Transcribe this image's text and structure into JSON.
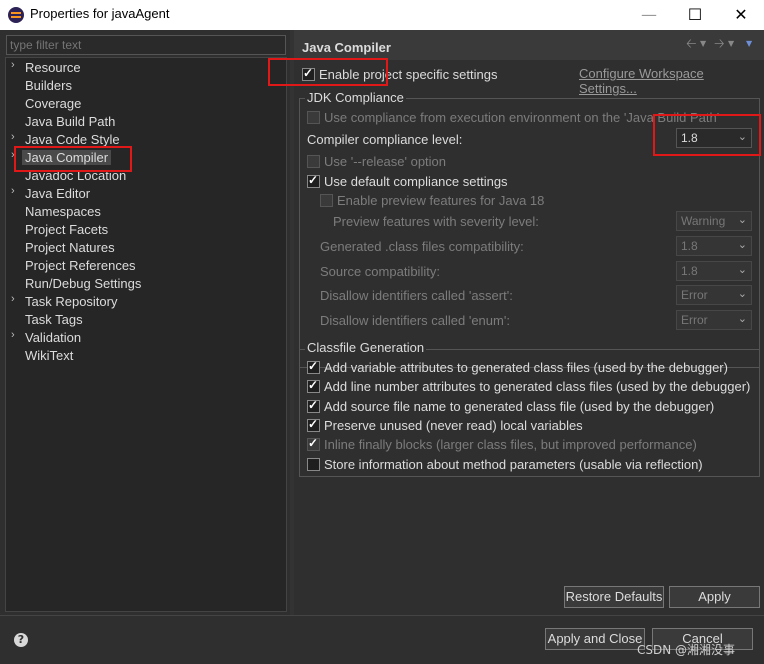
{
  "window": {
    "title": "Properties for javaAgent"
  },
  "filter": {
    "placeholder": "type filter text"
  },
  "tree": [
    {
      "label": "Resource",
      "expandable": true
    },
    {
      "label": "Builders",
      "expandable": false
    },
    {
      "label": "Coverage",
      "expandable": false
    },
    {
      "label": "Java Build Path",
      "expandable": false
    },
    {
      "label": "Java Code Style",
      "expandable": true
    },
    {
      "label": "Java Compiler",
      "expandable": true,
      "selected": true
    },
    {
      "label": "Javadoc Location",
      "expandable": false
    },
    {
      "label": "Java Editor",
      "expandable": true
    },
    {
      "label": "Namespaces",
      "expandable": false
    },
    {
      "label": "Project Facets",
      "expandable": false
    },
    {
      "label": "Project Natures",
      "expandable": false
    },
    {
      "label": "Project References",
      "expandable": false
    },
    {
      "label": "Run/Debug Settings",
      "expandable": false
    },
    {
      "label": "Task Repository",
      "expandable": true
    },
    {
      "label": "Task Tags",
      "expandable": false
    },
    {
      "label": "Validation",
      "expandable": true
    },
    {
      "label": "WikiText",
      "expandable": false
    }
  ],
  "page": {
    "title": "Java Compiler",
    "enable_project_specific": "Enable project specific settings",
    "configure_workspace": "Configure Workspace Settings...",
    "jdk_group": "JDK Compliance",
    "use_compliance_build_path": "Use compliance from execution environment on the 'Java Build Path'",
    "compliance_level_label": "Compiler compliance level:",
    "compliance_level_value": "1.8",
    "use_release": "Use '--release' option",
    "use_default_compliance": "Use default compliance settings",
    "enable_preview": "Enable preview features for Java 18",
    "preview_severity_label": "Preview features with severity level:",
    "preview_severity_value": "Warning",
    "generated_class_label": "Generated .class files compatibility:",
    "generated_class_value": "1.8",
    "source_compat_label": "Source compatibility:",
    "source_compat_value": "1.8",
    "assert_label": "Disallow identifiers called 'assert':",
    "assert_value": "Error",
    "enum_label": "Disallow identifiers called 'enum':",
    "enum_value": "Error",
    "classfile_group": "Classfile Generation",
    "cf_variable": "Add variable attributes to generated class files (used by the debugger)",
    "cf_line": "Add line number attributes to generated class files (used by the debugger)",
    "cf_source": "Add source file name to generated class file (used by the debugger)",
    "cf_preserve": "Preserve unused (never read) local variables",
    "cf_inline": "Inline finally blocks (larger class files, but improved performance)",
    "cf_params": "Store information about method parameters (usable via reflection)",
    "restore_defaults": "Restore Defaults",
    "apply": "Apply"
  },
  "footer": {
    "help": "?",
    "apply_close": "Apply and Close",
    "cancel": "Cancel"
  },
  "watermark": "CSDN @湘湘没事"
}
